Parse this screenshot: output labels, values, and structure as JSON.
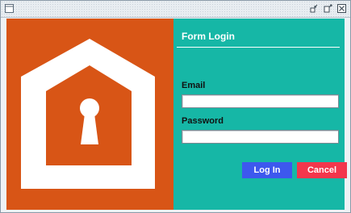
{
  "window": {
    "title": "",
    "controls": [
      "app-window-icon",
      "minimize-icon",
      "maximize-icon",
      "close-icon"
    ]
  },
  "hero": {
    "icon": "house-keyhole-icon",
    "panel_color": "#d85516",
    "icon_color": "#ffffff"
  },
  "form": {
    "title": "Form Login",
    "email_label": "Email",
    "email_value": "",
    "password_label": "Password",
    "password_value": "",
    "login_label": "Log In",
    "cancel_label": "Cancel",
    "panel_color": "#16b7a6",
    "login_color": "#3d58ee",
    "cancel_color": "#f3364c"
  }
}
